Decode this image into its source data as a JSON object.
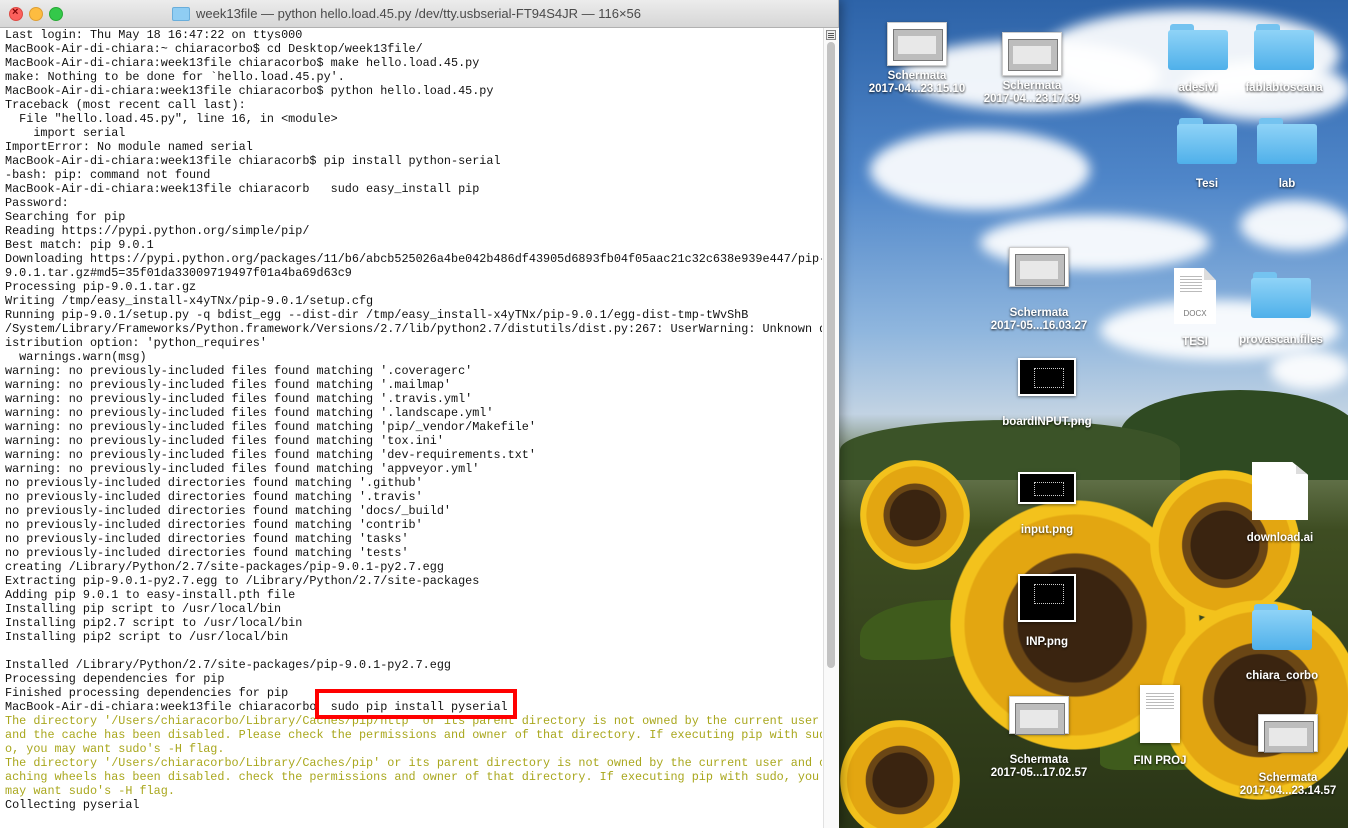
{
  "window": {
    "title": "week13file — python hello.load.45.py /dev/tty.usbserial-FT94S4JR — 116×56",
    "close_glyph": "×"
  },
  "terminal": {
    "lines": [
      {
        "text": "Last login: Thu May 18 16:47:22 on ttys000",
        "style": "normal"
      },
      {
        "text": "MacBook-Air-di-chiara:~ chiaracorbo$ cd Desktop/week13file/",
        "style": "normal"
      },
      {
        "text": "MacBook-Air-di-chiara:week13file chiaracorbo$ make hello.load.45.py",
        "style": "normal"
      },
      {
        "text": "make: Nothing to be done for `hello.load.45.py'.",
        "style": "normal"
      },
      {
        "text": "MacBook-Air-di-chiara:week13file chiaracorbo$ python hello.load.45.py",
        "style": "normal"
      },
      {
        "text": "Traceback (most recent call last):",
        "style": "normal"
      },
      {
        "text": "  File \"hello.load.45.py\", line 16, in <module>",
        "style": "normal"
      },
      {
        "text": "    import serial",
        "style": "normal"
      },
      {
        "text": "ImportError: No module named serial",
        "style": "normal"
      },
      {
        "text": "MacBook-Air-di-chiara:week13file chiaracorb$ pip install python-serial",
        "style": "normal"
      },
      {
        "text": "-bash: pip: command not found",
        "style": "normal"
      },
      {
        "text": "MacBook-Air-di-chiara:week13file chiaracorb   sudo easy_install pip",
        "style": "normal"
      },
      {
        "text": "Password:",
        "style": "normal"
      },
      {
        "text": "Searching for pip",
        "style": "normal"
      },
      {
        "text": "Reading https://pypi.python.org/simple/pip/",
        "style": "normal"
      },
      {
        "text": "Best match: pip 9.0.1",
        "style": "normal"
      },
      {
        "text": "Downloading https://pypi.python.org/packages/11/b6/abcb525026a4be042b486df43905d6893fb04f05aac21c32c638e939e447/pip-",
        "style": "normal"
      },
      {
        "text": "9.0.1.tar.gz#md5=35f01da33009719497f01a4ba69d63c9",
        "style": "normal"
      },
      {
        "text": "Processing pip-9.0.1.tar.gz",
        "style": "normal"
      },
      {
        "text": "Writing /tmp/easy_install-x4yTNx/pip-9.0.1/setup.cfg",
        "style": "normal"
      },
      {
        "text": "Running pip-9.0.1/setup.py -q bdist_egg --dist-dir /tmp/easy_install-x4yTNx/pip-9.0.1/egg-dist-tmp-tWvShB",
        "style": "normal"
      },
      {
        "text": "/System/Library/Frameworks/Python.framework/Versions/2.7/lib/python2.7/distutils/dist.py:267: UserWarning: Unknown d",
        "style": "normal"
      },
      {
        "text": "istribution option: 'python_requires'",
        "style": "normal"
      },
      {
        "text": "  warnings.warn(msg)",
        "style": "normal"
      },
      {
        "text": "warning: no previously-included files found matching '.coveragerc'",
        "style": "normal"
      },
      {
        "text": "warning: no previously-included files found matching '.mailmap'",
        "style": "normal"
      },
      {
        "text": "warning: no previously-included files found matching '.travis.yml'",
        "style": "normal"
      },
      {
        "text": "warning: no previously-included files found matching '.landscape.yml'",
        "style": "normal"
      },
      {
        "text": "warning: no previously-included files found matching 'pip/_vendor/Makefile'",
        "style": "normal"
      },
      {
        "text": "warning: no previously-included files found matching 'tox.ini'",
        "style": "normal"
      },
      {
        "text": "warning: no previously-included files found matching 'dev-requirements.txt'",
        "style": "normal"
      },
      {
        "text": "warning: no previously-included files found matching 'appveyor.yml'",
        "style": "normal"
      },
      {
        "text": "no previously-included directories found matching '.github'",
        "style": "normal"
      },
      {
        "text": "no previously-included directories found matching '.travis'",
        "style": "normal"
      },
      {
        "text": "no previously-included directories found matching 'docs/_build'",
        "style": "normal"
      },
      {
        "text": "no previously-included directories found matching 'contrib'",
        "style": "normal"
      },
      {
        "text": "no previously-included directories found matching 'tasks'",
        "style": "normal"
      },
      {
        "text": "no previously-included directories found matching 'tests'",
        "style": "normal"
      },
      {
        "text": "creating /Library/Python/2.7/site-packages/pip-9.0.1-py2.7.egg",
        "style": "normal"
      },
      {
        "text": "Extracting pip-9.0.1-py2.7.egg to /Library/Python/2.7/site-packages",
        "style": "normal"
      },
      {
        "text": "Adding pip 9.0.1 to easy-install.pth file",
        "style": "normal"
      },
      {
        "text": "Installing pip script to /usr/local/bin",
        "style": "normal"
      },
      {
        "text": "Installing pip2.7 script to /usr/local/bin",
        "style": "normal"
      },
      {
        "text": "Installing pip2 script to /usr/local/bin",
        "style": "normal"
      },
      {
        "text": "",
        "style": "normal"
      },
      {
        "text": "Installed /Library/Python/2.7/site-packages/pip-9.0.1-py2.7.egg",
        "style": "normal"
      },
      {
        "text": "Processing dependencies for pip",
        "style": "normal"
      },
      {
        "text": "Finished processing dependencies for pip",
        "style": "normal"
      },
      {
        "text": "MacBook-Air-di-chiara:week13file chiaracorbo  sudo pip install pyserial",
        "style": "normal"
      },
      {
        "text": "The directory '/Users/chiaracorbo/Library/Caches/pip/http' or its parent directory is not owned by the current user",
        "style": "warn"
      },
      {
        "text": "and the cache has been disabled. Please check the permissions and owner of that directory. If executing pip with sudo",
        "style": "warn"
      },
      {
        "text": "o, you may want sudo's -H flag.",
        "style": "warn"
      },
      {
        "text": "The directory '/Users/chiaracorbo/Library/Caches/pip' or its parent directory is not owned by the current user and c",
        "style": "warn"
      },
      {
        "text": "aching wheels has been disabled. check the permissions and owner of that directory. If executing pip with sudo, you",
        "style": "warn"
      },
      {
        "text": "may want sudo's -H flag.",
        "style": "warn"
      },
      {
        "text": "Collecting pyserial",
        "style": "normal"
      }
    ]
  },
  "desktop": {
    "icons": [
      {
        "label": "Schermata\n2017-04...23.15.10",
        "kind": "screenshot"
      },
      {
        "label": "Schermata\n2017-04...23.17.39",
        "kind": "screenshot"
      },
      {
        "label": "adesivi",
        "kind": "folder"
      },
      {
        "label": "fablabtoscana",
        "kind": "folder"
      },
      {
        "label": "Tesi",
        "kind": "folder"
      },
      {
        "label": "lab",
        "kind": "folder"
      },
      {
        "label": "Schermata\n2017-05...16.03.27",
        "kind": "screenshot"
      },
      {
        "label": "TESI",
        "kind": "docx",
        "ext": "DOCX"
      },
      {
        "label": "provascan.files",
        "kind": "folder"
      },
      {
        "label": "boardINPUT.png",
        "kind": "image-dark"
      },
      {
        "label": "input.png",
        "kind": "image-dark"
      },
      {
        "label": "download.ai",
        "kind": "document"
      },
      {
        "label": "INP.png",
        "kind": "image-dark"
      },
      {
        "label": "chiara_corbo",
        "kind": "folder"
      },
      {
        "label": "Schermata\n2017-05...17.02.57",
        "kind": "screenshot"
      },
      {
        "label": "FIN PROJ",
        "kind": "document"
      },
      {
        "label": "Schermata\n2017-04...23.14.57",
        "kind": "screenshot"
      }
    ]
  }
}
